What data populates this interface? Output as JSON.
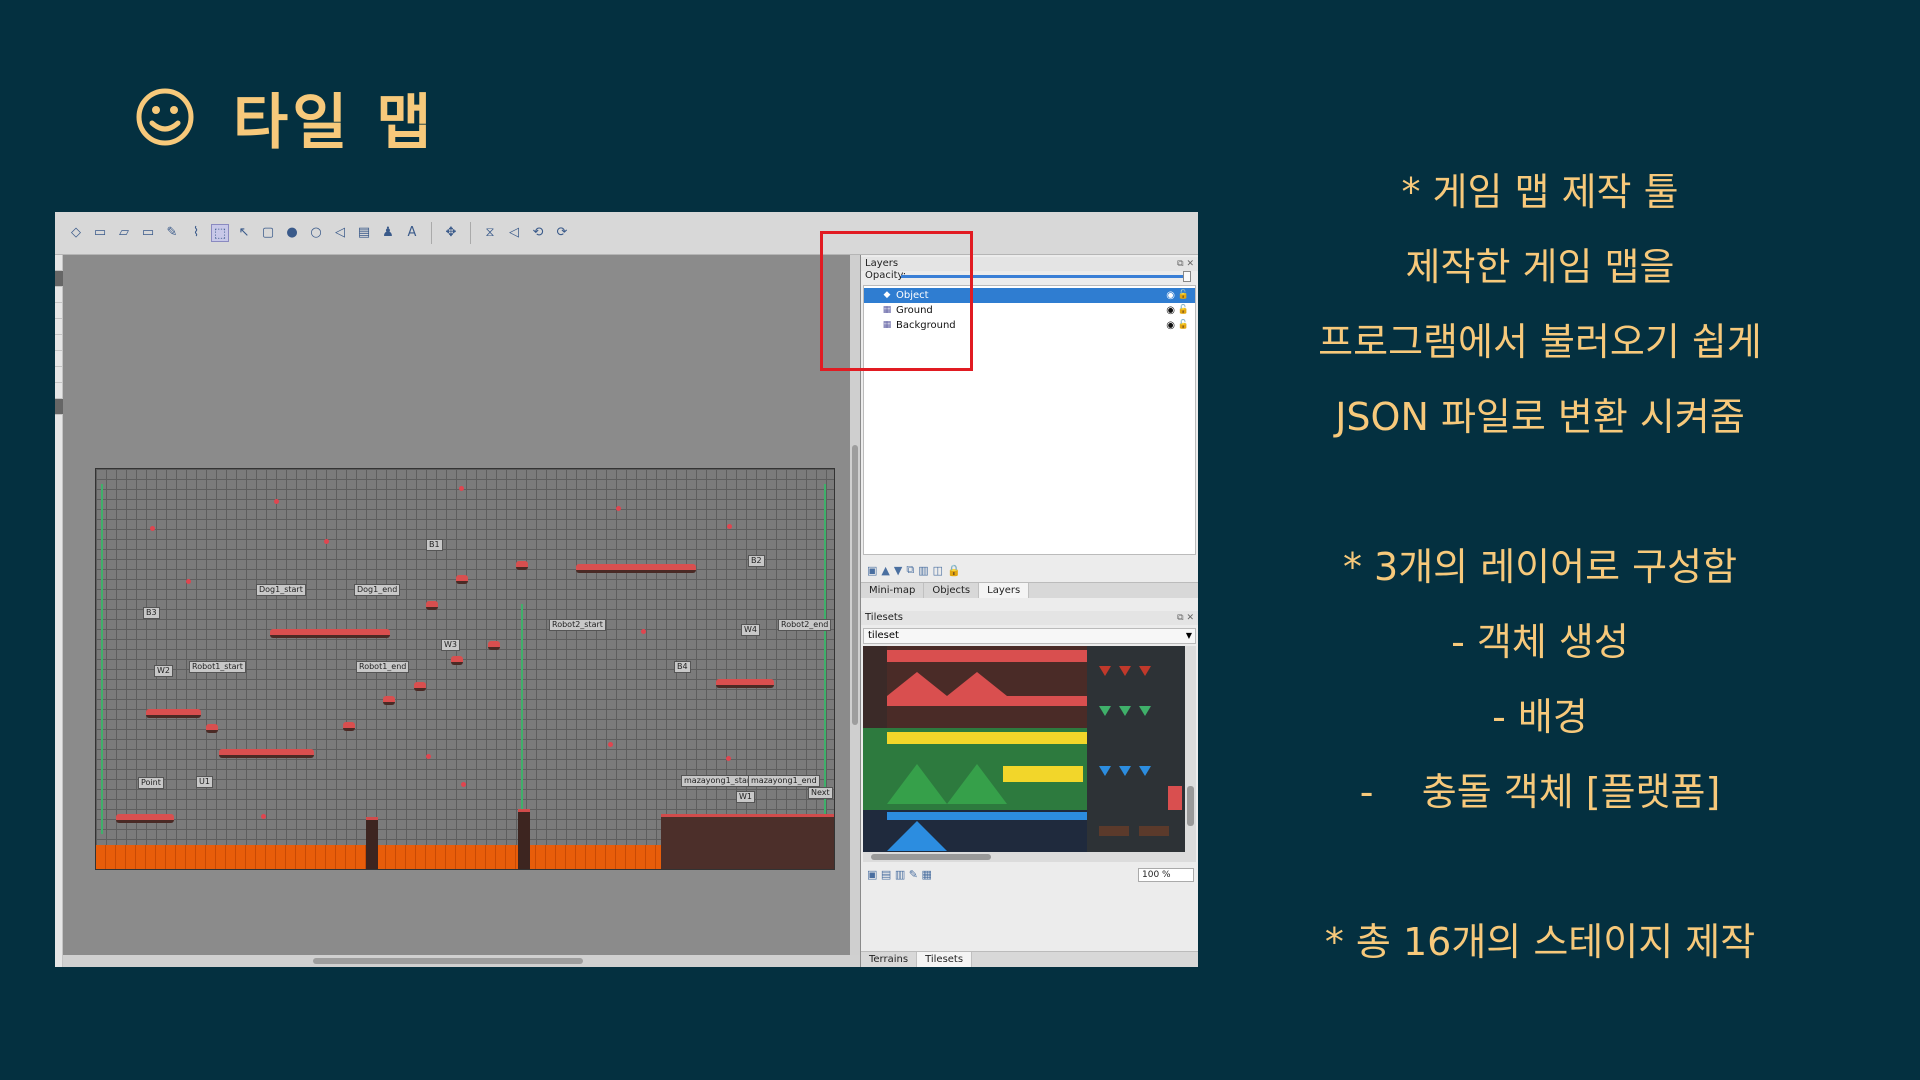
{
  "slide": {
    "title": "타일 맵",
    "title_icon": "smiley-icon",
    "accent_color": "#f7c97b",
    "background_color": "#043040",
    "notes": [
      "* 게임 맵 제작 툴",
      "제작한 게임 맵을",
      "프로그램에서 불러오기 쉽게",
      "JSON 파일로 변환 시켜줌",
      "",
      "* 3개의 레이어로 구성함",
      "- 객체 생성",
      "- 배경",
      "-    충돌 객체 [플랫폼]",
      "",
      "* 총 16개의 스테이지 제작"
    ]
  },
  "editor": {
    "layers_panel": {
      "title": "Layers",
      "opacity_label": "Opacity:",
      "layers": [
        {
          "name": "Object",
          "selected": true,
          "visible": true
        },
        {
          "name": "Ground",
          "selected": false,
          "visible": true
        },
        {
          "name": "Background",
          "selected": false,
          "visible": true
        }
      ],
      "tabs": [
        "Mini-map",
        "Objects",
        "Layers"
      ],
      "active_tab": "Layers"
    },
    "tilesets_panel": {
      "title": "Tilesets",
      "selected_tileset": "tileset",
      "zoom": "100 %",
      "tabs": [
        "Terrains",
        "Tilesets"
      ],
      "active_tab": "Tilesets"
    },
    "map_labels": [
      "Dog1_start",
      "Dog1_end",
      "B1",
      "B2",
      "Robot2_start",
      "Robot2_end",
      "W4",
      "B4",
      "W3",
      "Robot1_start",
      "Robot1_end",
      "B3",
      "W2",
      "B2",
      "Point",
      "U1",
      "mazayong1_start",
      "mazayong1_end",
      "Next",
      "W1"
    ]
  }
}
